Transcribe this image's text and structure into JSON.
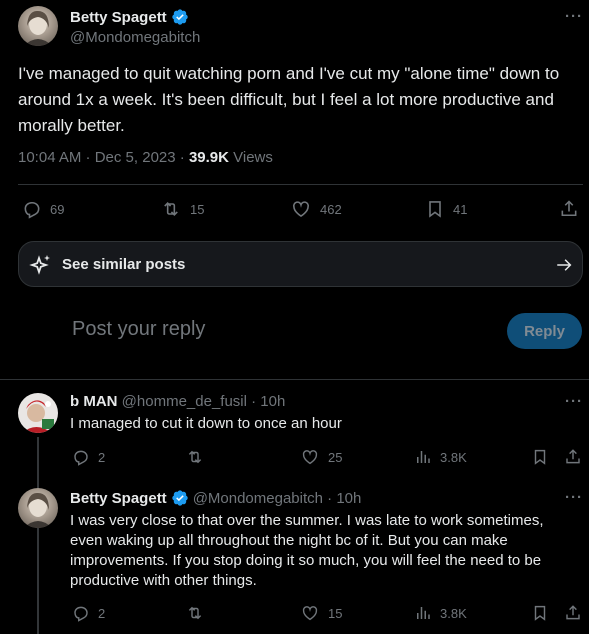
{
  "main_tweet": {
    "author_name": "Betty Spagett",
    "author_handle": "@Mondomegabitch",
    "verified": true,
    "text": "I've managed to quit watching porn and I've cut my \"alone time\" down to around 1x a week. It's been difficult, but I feel a lot more productive and morally better.",
    "time": "10:04 AM · Dec 5, 2023 · ",
    "views_count": "39.9K",
    "views_label": " Views",
    "replies": "69",
    "reposts": "15",
    "likes": "462",
    "bookmarks": "41"
  },
  "similar_posts": {
    "label": "See similar posts"
  },
  "reply_composer": {
    "placeholder": "Post your reply",
    "button_label": "Reply"
  },
  "replies": [
    {
      "author_name": "b MAN",
      "author_handle": "@homme_de_fusil · 10h",
      "text": "I managed to cut it down to once an hour",
      "replies": "2",
      "reposts": "",
      "likes": "25",
      "views": "3.8K"
    },
    {
      "author_name": "Betty Spagett",
      "author_handle": "@Mondomegabitch · 10h",
      "verified": true,
      "text": "I was very close to that over the summer. I was late to work sometimes, even waking up all throughout the night bc of it. But you can make improvements. If you stop doing it so much, you will feel the need to be productive with other things.",
      "replies": "2",
      "reposts": "",
      "likes": "15",
      "views": "3.8K"
    }
  ],
  "colors": {
    "background": "#000000",
    "text": "#e7e9ea",
    "muted": "#71767b",
    "accent": "#1d9bf0",
    "reply_button": "#0f4e78",
    "divider": "#2f3336"
  }
}
